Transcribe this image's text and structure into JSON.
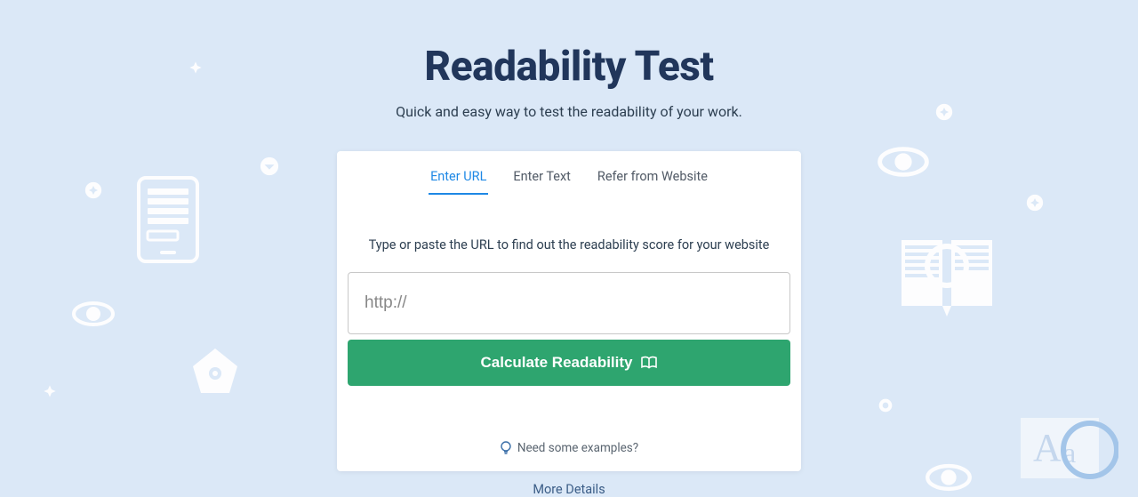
{
  "header": {
    "title": "Readability Test",
    "subtitle": "Quick and easy way to test the readability of your work."
  },
  "tabs": [
    {
      "label": "Enter URL",
      "active": true
    },
    {
      "label": "Enter Text",
      "active": false
    },
    {
      "label": "Refer from Website",
      "active": false
    }
  ],
  "form": {
    "instruction": "Type or paste the URL to find out the readability score for your website",
    "placeholder": "http://",
    "button_label": "Calculate Readability"
  },
  "examples_label": "Need some examples?",
  "more_details": "More Details",
  "colors": {
    "bg": "#dbe8f7",
    "title": "#21365b",
    "accent": "#1e88e5",
    "cta": "#2ea56f"
  }
}
